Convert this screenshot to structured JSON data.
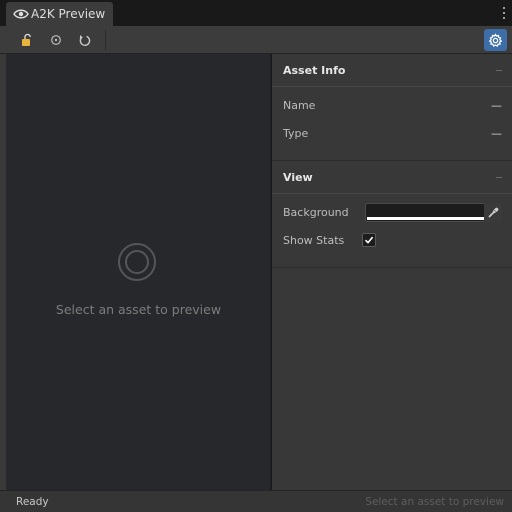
{
  "window": {
    "tab_title": "A2K Preview",
    "tab_icon": "eye-icon"
  },
  "toolbar": {
    "buttons": [
      {
        "icon": "lock-icon",
        "color": "#e8b53a"
      },
      {
        "icon": "target-icon"
      },
      {
        "icon": "reset-icon"
      }
    ],
    "settings_icon": "gear-icon",
    "accent": "#3d6ea8"
  },
  "preview": {
    "empty_message": "Select an asset to preview",
    "background": "#27282c"
  },
  "inspector": {
    "asset_info": {
      "title": "Asset Info",
      "collapse": "–",
      "rows": [
        {
          "label": "Name",
          "value": "—"
        },
        {
          "label": "Type",
          "value": "—"
        }
      ]
    },
    "view": {
      "title": "View",
      "collapse": "–",
      "background_label": "Background",
      "background_color": "#ffffff",
      "show_stats_label": "Show Stats",
      "show_stats_checked": true
    }
  },
  "status": {
    "left": "Ready",
    "right": "Select an asset to preview"
  }
}
